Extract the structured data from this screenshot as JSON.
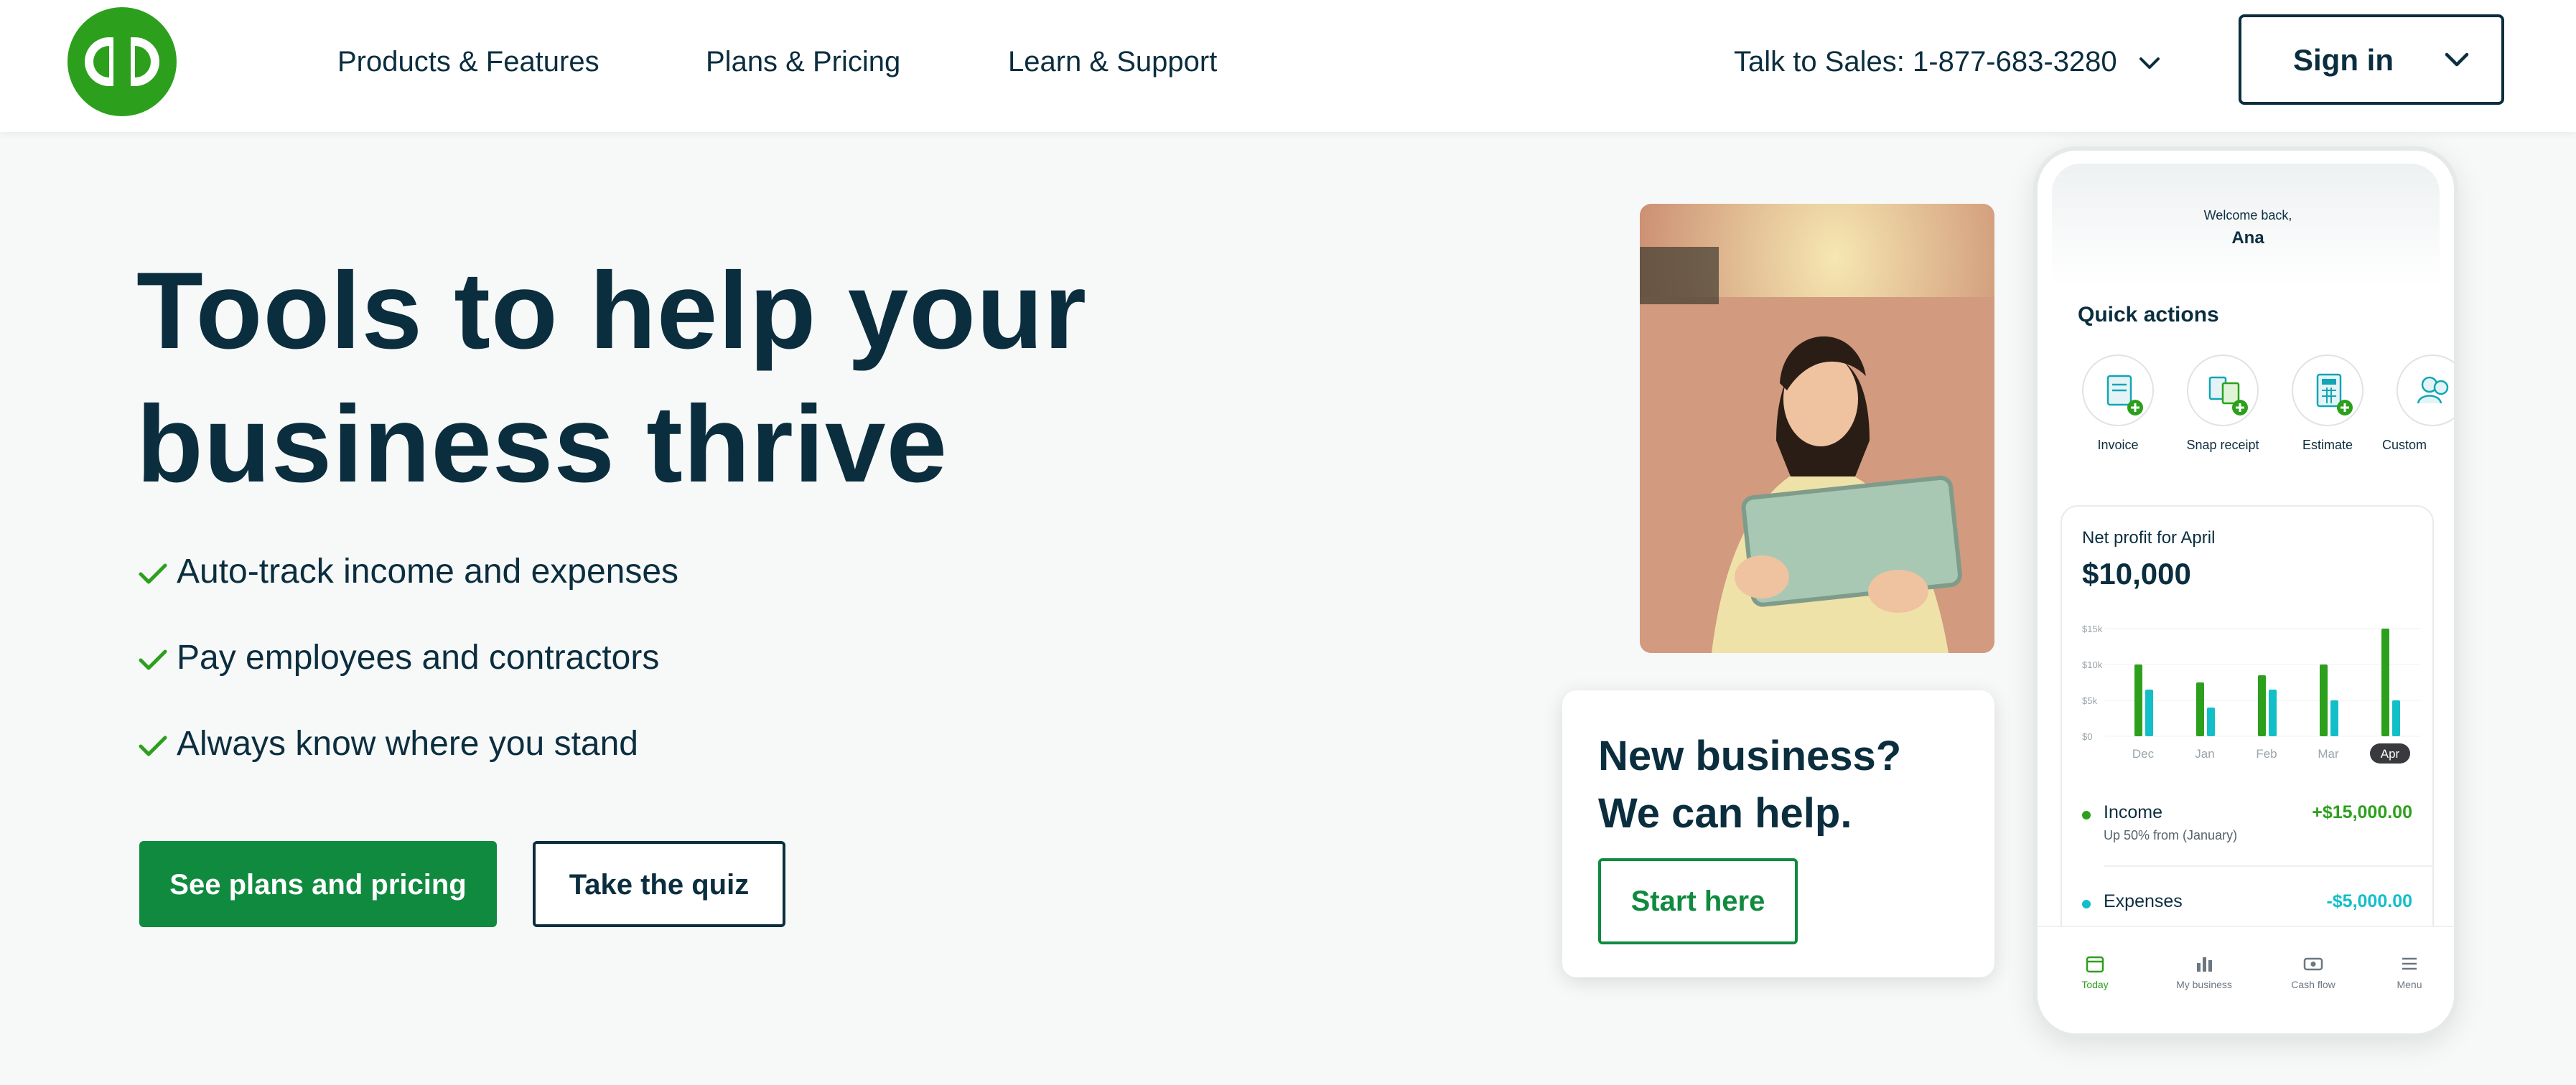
{
  "header": {
    "logo_text": "qb",
    "nav": [
      "Products & Features",
      "Plans & Pricing",
      "Learn & Support"
    ],
    "sales_label": "Talk to Sales: 1-877-683-3280",
    "signin_label": "Sign in"
  },
  "hero": {
    "headline_line1": "Tools to help your",
    "headline_line2": "business thrive",
    "features": [
      "Auto-track income and expenses",
      "Pay employees and contractors",
      "Always know where you stand"
    ],
    "primary_cta": "See plans and pricing",
    "secondary_cta": "Take the quiz"
  },
  "promo_card": {
    "title_line1": "New business?",
    "title_line2": "We can help.",
    "button": "Start here"
  },
  "phone": {
    "welcome": "Welcome back,",
    "user_name": "Ana",
    "quick_actions_title": "Quick actions",
    "quick_actions": [
      "Invoice",
      "Snap receipt",
      "Estimate",
      "Custom"
    ],
    "net_profit_label": "Net profit for April",
    "net_profit_value": "$10,000",
    "income": {
      "label": "Income",
      "value": "+$15,000.00",
      "sub": "Up 50% from (January)"
    },
    "expenses": {
      "label": "Expenses",
      "value": "-$5,000.00"
    },
    "tabs": [
      "Today",
      "My business",
      "Cash flow",
      "Menu"
    ]
  },
  "chart_data": {
    "type": "bar",
    "categories": [
      "Dec",
      "Jan",
      "Feb",
      "Mar",
      "Apr"
    ],
    "y_tick_labels": [
      "$15k",
      "$10k",
      "$5k",
      "$0"
    ],
    "ylim": [
      0,
      15
    ],
    "series": [
      {
        "name": "Income",
        "values": [
          10,
          7.5,
          8.5,
          10,
          15
        ]
      },
      {
        "name": "Expenses",
        "values": [
          6.5,
          4,
          6.5,
          5,
          5
        ]
      }
    ],
    "selected_category": "Apr"
  },
  "colors": {
    "brand_green": "#2ca01c",
    "button_green": "#108a3f",
    "navy": "#0b2e3f",
    "expense_teal": "#12bfc9",
    "income_green": "#2ca01c"
  }
}
